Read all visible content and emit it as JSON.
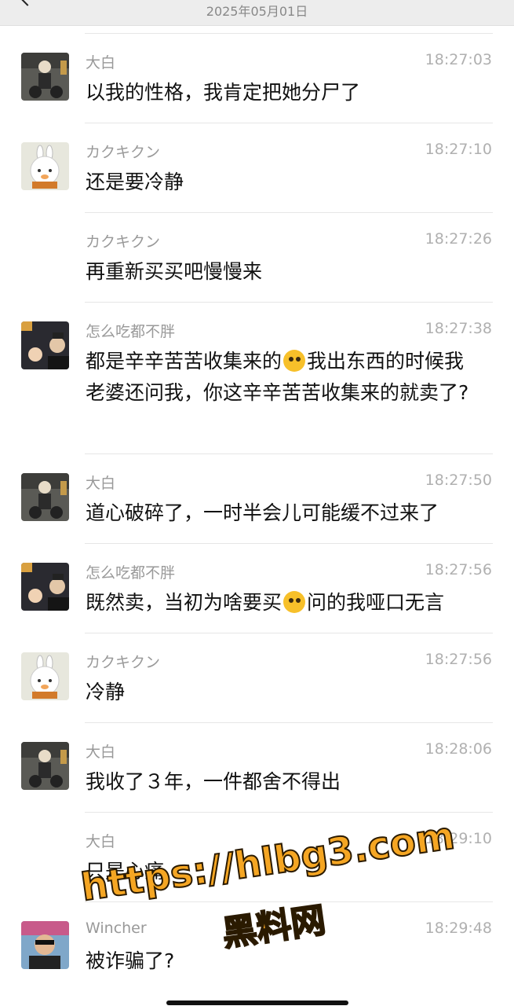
{
  "header": {
    "date": "2025年05月01日"
  },
  "messages": [
    {
      "name": "大白",
      "time": "18:27:03",
      "avatar": "moto",
      "segments": [
        {
          "t": "text",
          "v": "以我的性格，我肯定把她分尸了"
        }
      ]
    },
    {
      "name": "カクキクン",
      "time": "18:27:10",
      "avatar": "bunny",
      "segments": [
        {
          "t": "text",
          "v": "还是要冷静"
        }
      ]
    },
    {
      "name": "カクキクン",
      "time": "18:27:26",
      "avatar": "none",
      "segments": [
        {
          "t": "text",
          "v": "再重新买买吧慢慢来"
        }
      ]
    },
    {
      "name": "怎么吃都不胖",
      "time": "18:27:38",
      "avatar": "couple",
      "segments": [
        {
          "t": "text",
          "v": "都是辛辛苦苦收集来的"
        },
        {
          "t": "emoji",
          "v": "money-face-emoji"
        },
        {
          "t": "text",
          "v": "我出东西的时候我老婆还问我，你这辛辛苦苦收集来的就卖了?"
        }
      ]
    },
    {
      "name": "大白",
      "time": "18:27:50",
      "avatar": "moto",
      "segments": [
        {
          "t": "text",
          "v": "道心破碎了，一时半会儿可能缓不过来了"
        }
      ]
    },
    {
      "name": "怎么吃都不胖",
      "time": "18:27:56",
      "avatar": "couple",
      "segments": [
        {
          "t": "text",
          "v": "既然卖，当初为啥要买"
        },
        {
          "t": "emoji",
          "v": "crying-emoji"
        },
        {
          "t": "text",
          "v": "问的我哑口无言"
        }
      ]
    },
    {
      "name": "カクキクン",
      "time": "18:27:56",
      "avatar": "bunny",
      "segments": [
        {
          "t": "text",
          "v": "冷静"
        }
      ]
    },
    {
      "name": "大白",
      "time": "18:28:06",
      "avatar": "moto",
      "segments": [
        {
          "t": "text",
          "v": "我收了３年，一件都舍不得出"
        }
      ]
    },
    {
      "name": "大白",
      "time": "18:29:10",
      "avatar": "none",
      "segments": [
        {
          "t": "text",
          "v": "只是心痛"
        }
      ]
    },
    {
      "name": "Wincher",
      "time": "18:29:48",
      "avatar": "man",
      "segments": [
        {
          "t": "text",
          "v": "被诈骗了?"
        }
      ]
    }
  ],
  "watermark": {
    "url": "https://hlbg3.com",
    "cn": "黑料网"
  }
}
